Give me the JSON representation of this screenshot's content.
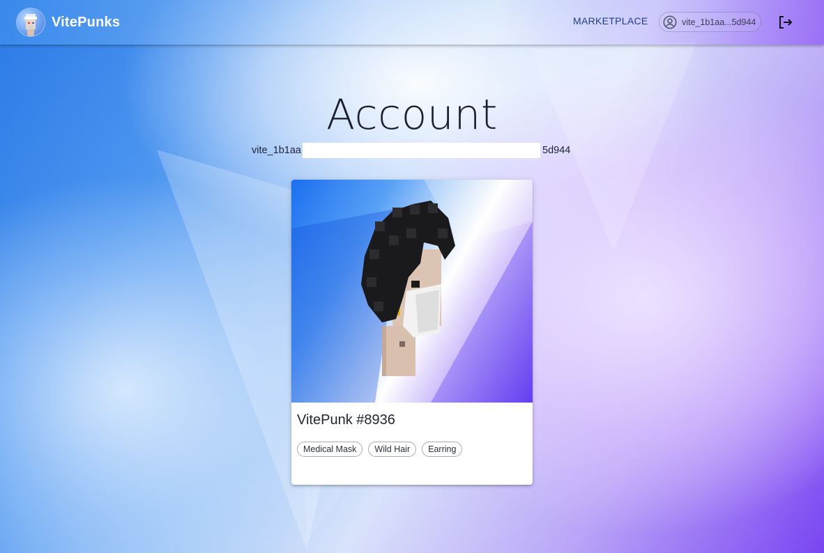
{
  "header": {
    "brand": "VitePunks",
    "logo_icon": "vitepunk-avatar-icon",
    "nav": {
      "marketplace_label": "MARKETPLACE"
    },
    "account_chip": {
      "label": "vite_1b1aa...5d944",
      "icon": "account-circle-icon"
    },
    "logout_icon": "logout-icon"
  },
  "page": {
    "title": "Account",
    "address": {
      "prefix": "vite_1b1aa",
      "suffix": "5d944"
    }
  },
  "card": {
    "title": "VitePunk #8936",
    "image_icon": "punk-image",
    "traits": [
      "Medical Mask",
      "Wild Hair",
      "Earring"
    ]
  },
  "colors": {
    "nav_text": "#1f3b8f",
    "title_text": "#1c1f2e",
    "card_bg": "#ffffff",
    "chip_border": "#a9a9b4"
  }
}
